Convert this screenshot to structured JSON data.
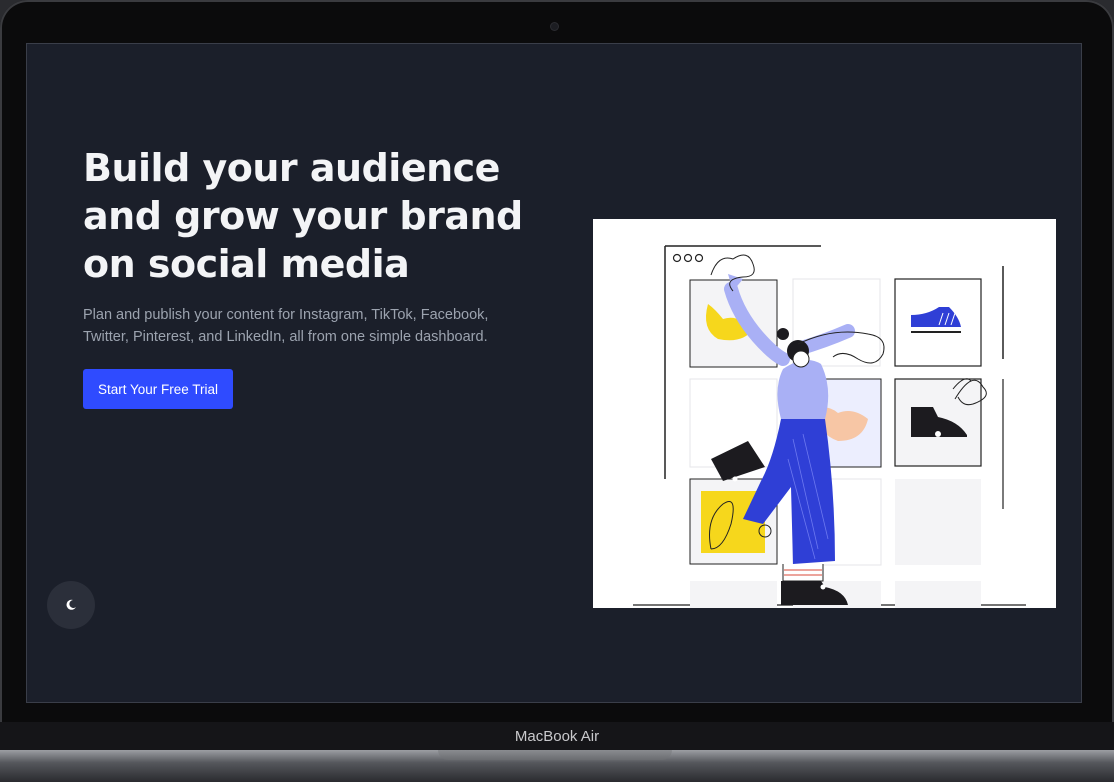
{
  "device": {
    "model_label": "MacBook Air"
  },
  "hero": {
    "title": "Build your audience and grow your brand on social media",
    "subtitle": "Plan and publish your content for Instagram, TikTok, Facebook, Twitter, Pinterest, and LinkedIn, all from one simple dashboard.",
    "cta_label": "Start Your Free Trial"
  },
  "theme_toggle": {
    "icon": "moon-icon"
  },
  "colors": {
    "background": "#1b1f2a",
    "accent": "#2f4bff",
    "title": "#f3f4f6",
    "subtitle": "#9ca3af",
    "illustration_blue": "#2f3fd6",
    "illustration_lavender": "#a9b0f5",
    "illustration_yellow": "#f6d71c",
    "illustration_peach": "#f7c6a5"
  }
}
